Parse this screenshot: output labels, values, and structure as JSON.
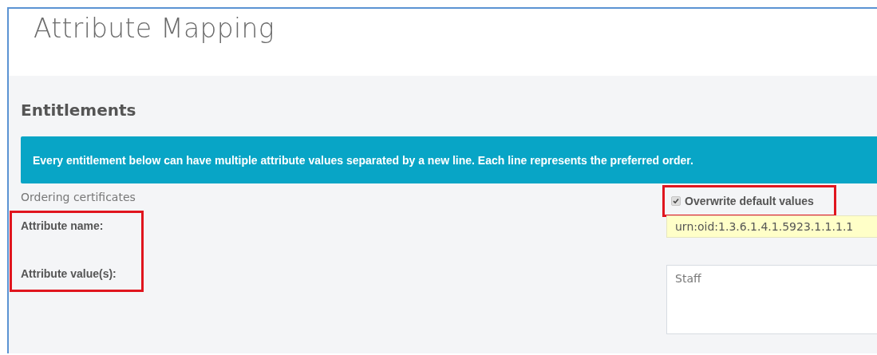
{
  "page": {
    "title": "Attribute Mapping"
  },
  "section": {
    "title": "Entitlements",
    "notice": "Every entitlement below can have multiple attribute values separated by a new line. Each line represents the preferred order.",
    "entitlement": {
      "name": "Ordering certificates",
      "name_label": "Attribute name:",
      "values_label": "Attribute value(s):",
      "overwrite": {
        "label": "Overwrite default values",
        "checked": true
      },
      "name_value": "urn:oid:1.3.6.1.4.1.5923.1.1.1.1",
      "values_value": "Staff"
    }
  }
}
